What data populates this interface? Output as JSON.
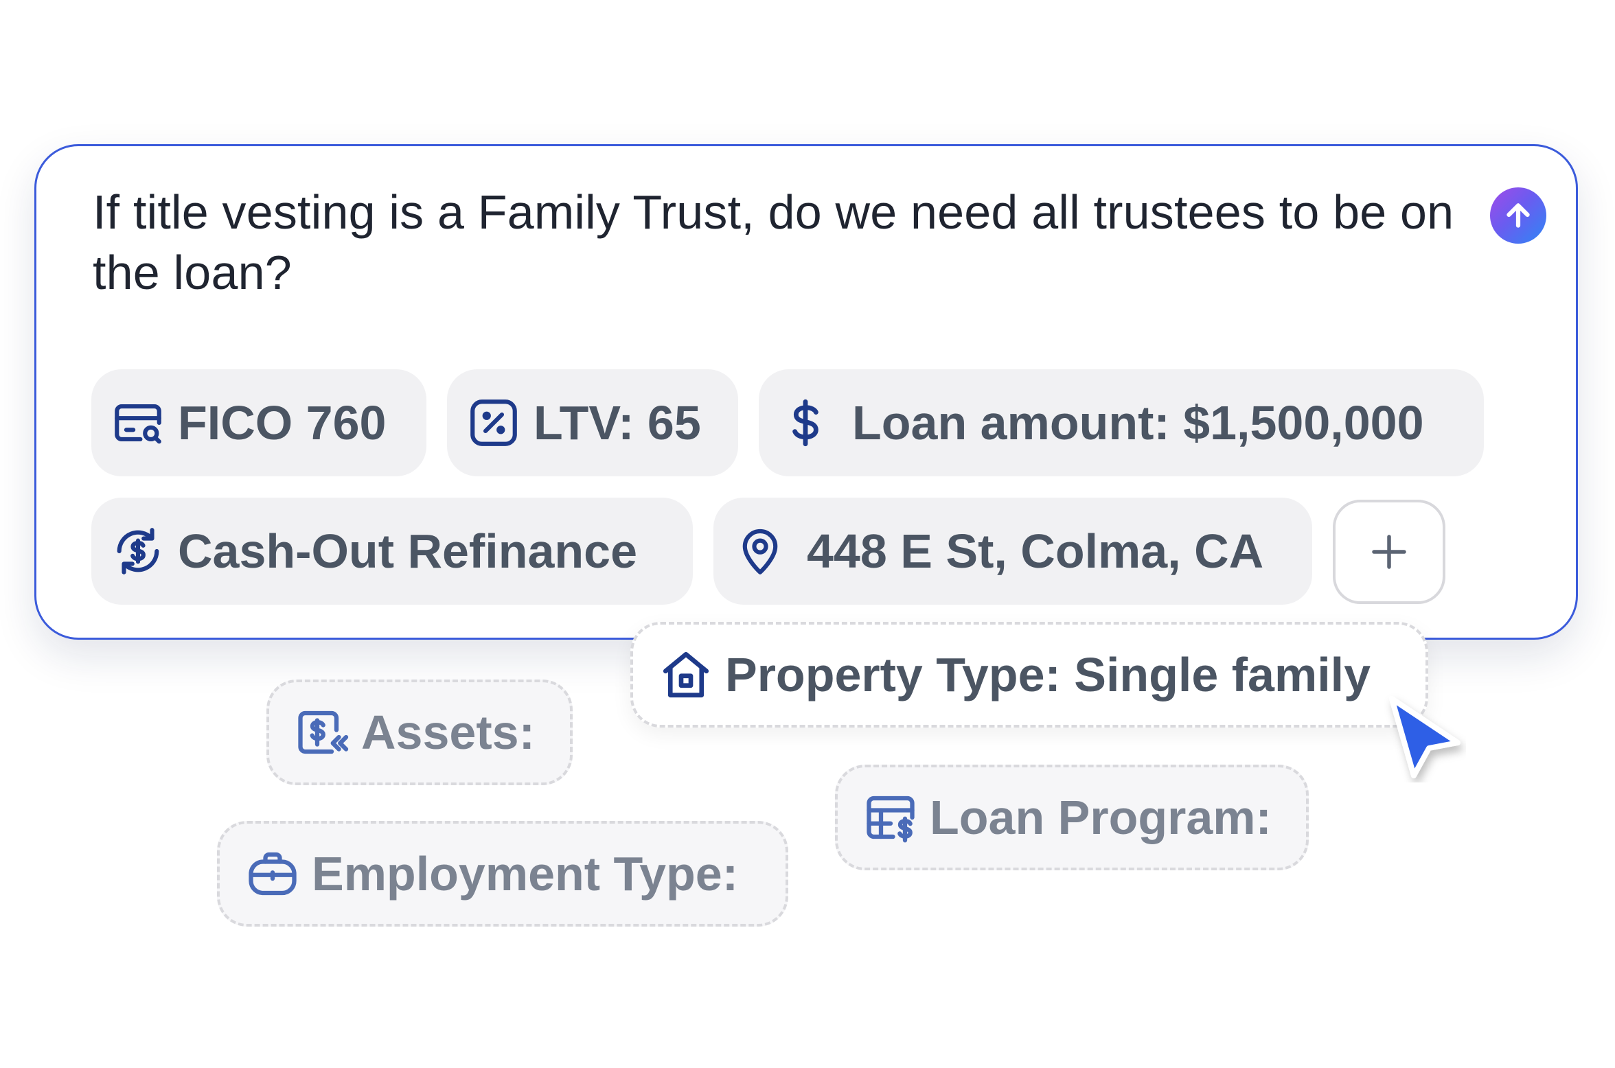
{
  "composer": {
    "question": "If title vesting is a Family Trust, do we need all trustees to be on the loan?",
    "send_icon": "arrow-up-icon",
    "accent": "#3b5bdb",
    "chips": [
      {
        "label": "FICO 760",
        "icon": "credit-score-icon"
      },
      {
        "label": "LTV: 65",
        "icon": "percent-icon"
      },
      {
        "label": "Loan amount: $1,500,000",
        "icon": "dollar-icon"
      },
      {
        "label": "Cash-Out Refinance",
        "icon": "refinance-icon"
      },
      {
        "label": "448 E St, Colma, CA",
        "icon": "location-pin-icon"
      }
    ],
    "add_label": "+"
  },
  "suggestions": [
    {
      "label": "Property Type: Single family",
      "icon": "house-icon",
      "active": true
    },
    {
      "label": "Assets:",
      "icon": "assets-icon"
    },
    {
      "label": "Loan Program:",
      "icon": "loan-program-icon"
    },
    {
      "label": "Employment Type:",
      "icon": "briefcase-icon"
    }
  ],
  "colors": {
    "icon": "#1e3a8a",
    "ghost_icon": "#4a6bb8",
    "cursor": "#2f5fe6"
  }
}
